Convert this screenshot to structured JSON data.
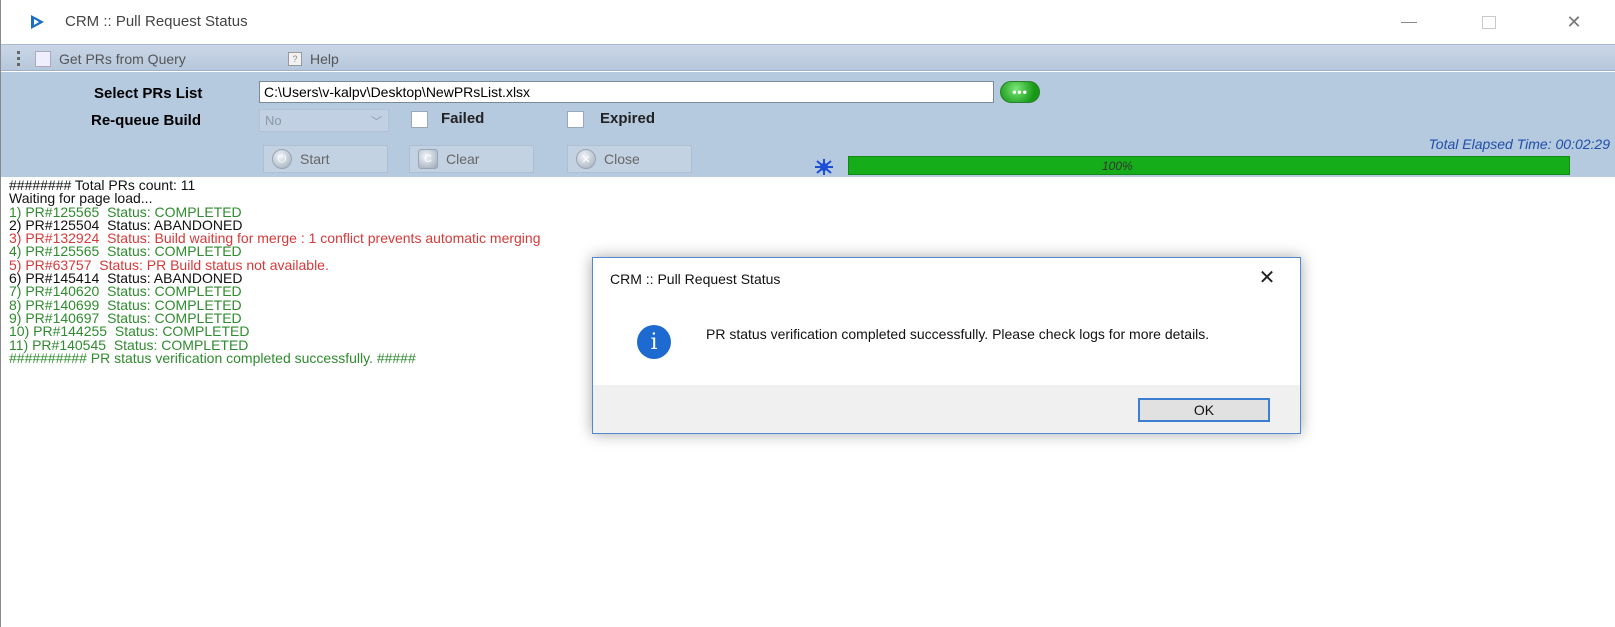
{
  "window": {
    "title": "CRM :: Pull Request Status",
    "icon": "dynamics-arrow-icon"
  },
  "menu": {
    "get_prs": "Get PRs from Query",
    "help": "Help"
  },
  "form": {
    "select_label": "Select PRs List",
    "path_value": "C:\\Users\\v-kalpv\\Desktop\\NewPRsList.xlsx",
    "browse_label": "•••",
    "requeue_label": "Re-queue Build",
    "requeue_value": "No",
    "failed_label": "Failed",
    "expired_label": "Expired",
    "failed_checked": false,
    "expired_checked": false
  },
  "buttons": {
    "start": "Start",
    "clear": "Clear",
    "close": "Close"
  },
  "status": {
    "elapsed": "Total Elapsed Time: 00:02:29",
    "progress_text": "100%",
    "progress_fraction": 1.0
  },
  "log": [
    {
      "text": "######## Total PRs count: 11",
      "color": "black"
    },
    {
      "text": "Waiting for page load...",
      "color": "black"
    },
    {
      "text": "1) PR#125565  Status: COMPLETED",
      "color": "green"
    },
    {
      "text": "2) PR#125504  Status: ABANDONED",
      "color": "black"
    },
    {
      "text": "3) PR#132924  Status: Build waiting for merge : 1 conflict prevents automatic merging",
      "color": "red"
    },
    {
      "text": "4) PR#125565  Status: COMPLETED",
      "color": "green"
    },
    {
      "text": "5) PR#63757  Status: PR Build status not available.",
      "color": "red"
    },
    {
      "text": "6) PR#145414  Status: ABANDONED",
      "color": "black"
    },
    {
      "text": "7) PR#140620  Status: COMPLETED",
      "color": "green"
    },
    {
      "text": "8) PR#140699  Status: COMPLETED",
      "color": "green"
    },
    {
      "text": "9) PR#140697  Status: COMPLETED",
      "color": "green"
    },
    {
      "text": "10) PR#144255  Status: COMPLETED",
      "color": "green"
    },
    {
      "text": "11) PR#140545  Status: COMPLETED",
      "color": "green"
    },
    {
      "text": "########## PR status verification completed successfully. #####",
      "color": "green"
    }
  ],
  "dialog": {
    "title": "CRM :: Pull Request Status",
    "message": "PR status verification completed successfully. Please check logs for more details.",
    "ok": "OK",
    "icon": "info-icon"
  },
  "colors": {
    "panel": "#b5c9df",
    "progress": "#16ad1a",
    "log_green": "#2f8b2f",
    "log_red": "#d43a3a",
    "elapsed_text": "#1f4fa8",
    "dialog_accent": "#3c7fd0"
  }
}
